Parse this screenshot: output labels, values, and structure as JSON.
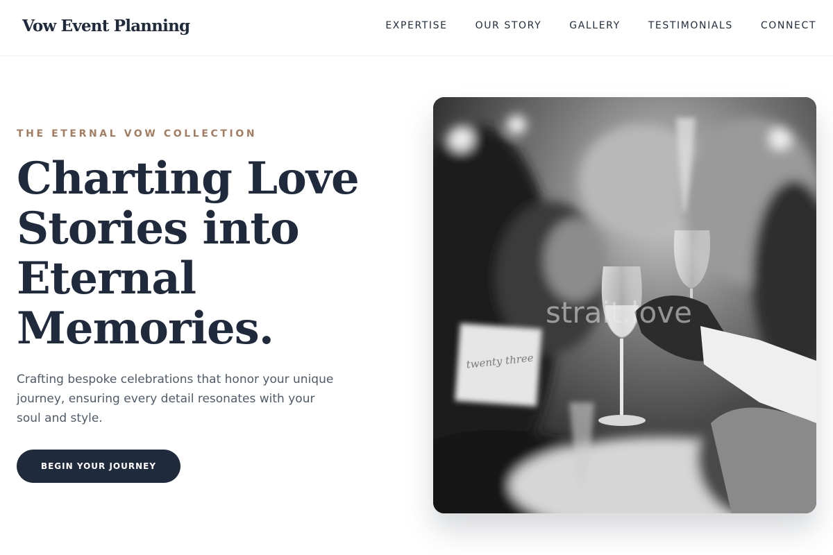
{
  "brand": {
    "name": "Vow Event Planning"
  },
  "nav": {
    "items": [
      {
        "label": "EXPERTISE"
      },
      {
        "label": "OUR STORY"
      },
      {
        "label": "GALLERY"
      },
      {
        "label": "TESTIMONIALS"
      },
      {
        "label": "CONNECT"
      }
    ]
  },
  "hero": {
    "eyebrow": "THE ETERNAL VOW COLLECTION",
    "headline": "Charting Love Stories into Eternal Memories.",
    "subtitle": "Crafting bespoke celebrations that honor your unique journey, ensuring every detail resonates with your soul and style.",
    "cta_label": "BEGIN YOUR JOURNEY",
    "image_watermark": "strait.love",
    "place_card_text": "twenty three"
  },
  "colors": {
    "primary": "#1f2a3d",
    "accent": "#a57c5f",
    "body_text": "#4f5a6a",
    "background": "#ffffff"
  }
}
